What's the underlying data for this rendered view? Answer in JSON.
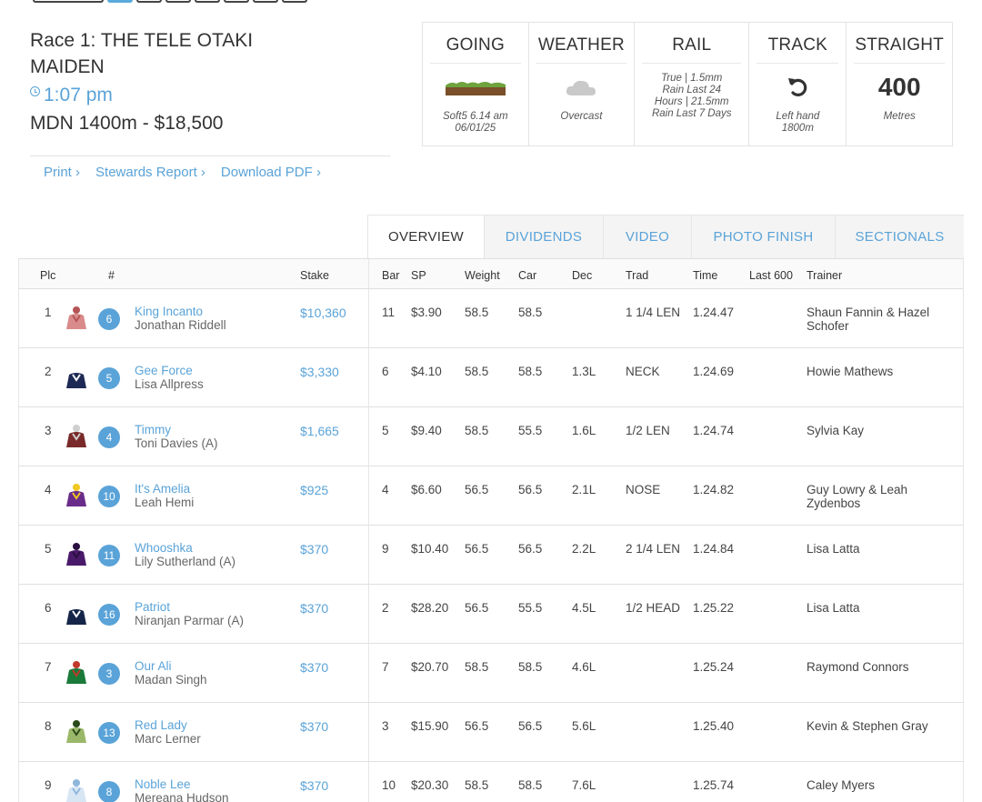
{
  "race": {
    "title": "Race 1: THE TELE OTAKI MAIDEN",
    "time": "1:07 pm",
    "class_info": "MDN 1400m - $18,500"
  },
  "links": [
    "Print ›",
    "Stewards Report ›",
    "Download PDF ›"
  ],
  "conditions": {
    "going": {
      "label": "GOING",
      "detail_line1": "Soft5 6.14 am",
      "detail_line2": "06/01/25"
    },
    "weather": {
      "label": "WEATHER",
      "detail": "Overcast",
      "icon": "cloud-icon"
    },
    "rail": {
      "label": "RAIL",
      "line1": "True | 1.5mm",
      "line2": "Rain Last 24",
      "line3": "Hours | 21.5mm",
      "line4": "Rain Last 7 Days"
    },
    "track": {
      "label": "TRACK",
      "detail_line1": "Left hand",
      "detail_line2": "1800m",
      "icon": "left-turn-arrow-icon"
    },
    "straight": {
      "label": "STRAIGHT",
      "value": "400",
      "unit": "Metres"
    }
  },
  "tabs": [
    "OVERVIEW",
    "DIVIDENDS",
    "VIDEO",
    "PHOTO FINISH",
    "SECTIONALS"
  ],
  "active_tab": "OVERVIEW",
  "columns": {
    "plc": "Plc",
    "num": "#",
    "stake": "Stake",
    "bar": "Bar",
    "sp": "SP",
    "weight": "Weight",
    "car": "Car",
    "dec": "Dec",
    "trad": "Trad",
    "time": "Time",
    "last600": "Last 600",
    "trainer": "Trainer"
  },
  "rows": [
    {
      "plc": "1",
      "num": "6",
      "horse": "King Incanto",
      "jockey": "Jonathan Riddell",
      "stake": "$10,360",
      "bar": "11",
      "sp": "$3.90",
      "weight": "58.5",
      "car": "58.5",
      "dec": "",
      "trad": "1 1/4 LEN",
      "time": "1.24.47",
      "last600": "",
      "trainer": "Shaun Fannin & Hazel Schofer",
      "silk_body": "#d98a8a",
      "silk_accent": "#b45555"
    },
    {
      "plc": "2",
      "num": "5",
      "horse": "Gee Force",
      "jockey": "Lisa Allpress",
      "stake": "$3,330",
      "bar": "6",
      "sp": "$4.10",
      "weight": "58.5",
      "car": "58.5",
      "dec": "1.3L",
      "trad": "NECK",
      "time": "1.24.69",
      "last600": "",
      "trainer": "Howie Mathews",
      "silk_body": "#1e2a55",
      "silk_accent": "#ffffff"
    },
    {
      "plc": "3",
      "num": "4",
      "horse": "Timmy",
      "jockey": "Toni Davies (A)",
      "stake": "$1,665",
      "bar": "5",
      "sp": "$9.40",
      "weight": "58.5",
      "car": "55.5",
      "dec": "1.6L",
      "trad": "1/2 LEN",
      "time": "1.24.74",
      "last600": "",
      "trainer": "Sylvia Kay",
      "silk_body": "#7a2a2a",
      "silk_accent": "#cfcfcf"
    },
    {
      "plc": "4",
      "num": "10",
      "horse": "It's Amelia",
      "jockey": "Leah Hemi",
      "stake": "$925",
      "bar": "4",
      "sp": "$6.60",
      "weight": "56.5",
      "car": "56.5",
      "dec": "2.1L",
      "trad": "NOSE",
      "time": "1.24.82",
      "last600": "",
      "trainer": "Guy Lowry & Leah Zydenbos",
      "silk_body": "#6a2c8a",
      "silk_accent": "#f2c820"
    },
    {
      "plc": "5",
      "num": "11",
      "horse": "Whooshka",
      "jockey": "Lily Sutherland (A)",
      "stake": "$370",
      "bar": "9",
      "sp": "$10.40",
      "weight": "56.5",
      "car": "56.5",
      "dec": "2.2L",
      "trad": "2 1/4 LEN",
      "time": "1.24.84",
      "last600": "",
      "trainer": "Lisa Latta",
      "silk_body": "#4a1a6a",
      "silk_accent": "#2a0f40"
    },
    {
      "plc": "6",
      "num": "16",
      "horse": "Patriot",
      "jockey": "Niranjan Parmar (A)",
      "stake": "$370",
      "bar": "2",
      "sp": "$28.20",
      "weight": "56.5",
      "car": "55.5",
      "dec": "4.5L",
      "trad": "1/2 HEAD",
      "time": "1.25.22",
      "last600": "",
      "trainer": "Lisa Latta",
      "silk_body": "#16264a",
      "silk_accent": "#ffffff"
    },
    {
      "plc": "7",
      "num": "3",
      "horse": "Our Ali",
      "jockey": "Madan Singh",
      "stake": "$370",
      "bar": "7",
      "sp": "$20.70",
      "weight": "58.5",
      "car": "58.5",
      "dec": "4.6L",
      "trad": "",
      "time": "1.25.24",
      "last600": "",
      "trainer": "Raymond Connors",
      "silk_body": "#1a7a3a",
      "silk_accent": "#c0392b"
    },
    {
      "plc": "8",
      "num": "13",
      "horse": "Red Lady",
      "jockey": "Marc Lerner",
      "stake": "$370",
      "bar": "3",
      "sp": "$15.90",
      "weight": "56.5",
      "car": "56.5",
      "dec": "5.6L",
      "trad": "",
      "time": "1.25.40",
      "last600": "",
      "trainer": "Kevin & Stephen Gray",
      "silk_body": "#9ab86a",
      "silk_accent": "#2a4a1a"
    },
    {
      "plc": "9",
      "num": "8",
      "horse": "Noble Lee",
      "jockey": "Mereana Hudson",
      "stake": "$370",
      "bar": "10",
      "sp": "$20.30",
      "weight": "58.5",
      "car": "58.5",
      "dec": "7.6L",
      "trad": "",
      "time": "1.25.74",
      "last600": "",
      "trainer": "Caley Myers",
      "silk_body": "#d8e6f4",
      "silk_accent": "#8fb6dc"
    }
  ]
}
